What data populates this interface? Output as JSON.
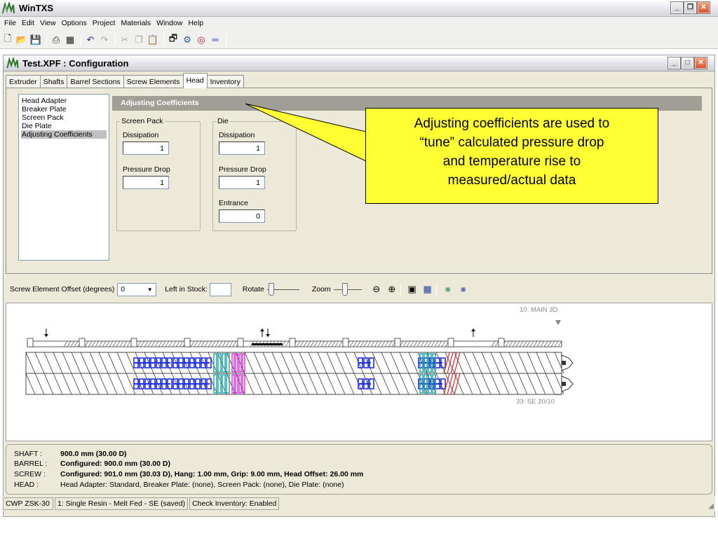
{
  "app": {
    "title": "WinTXS"
  },
  "menu": [
    "File",
    "Edit",
    "View",
    "Options",
    "Project",
    "Materials",
    "Window",
    "Help"
  ],
  "toolbar": {
    "icons": [
      "new-document-icon",
      "open-folder-icon",
      "save-icon",
      "print-icon",
      "print-preview-icon",
      "undo-icon",
      "redo-icon",
      "cut-icon",
      "copy-icon",
      "paste-icon",
      "properties-icon",
      "calculate-icon",
      "help-wheel-icon",
      "equals-icon"
    ]
  },
  "child_window": {
    "title": "Test.XPF : Configuration"
  },
  "tabs": [
    "Extruder",
    "Shafts",
    "Barrel Sections",
    "Screw Elements",
    "Head",
    "Inventory"
  ],
  "active_tab": "Head",
  "head_list": {
    "items": [
      "Head Adapter",
      "Breaker Plate",
      "Screen Pack",
      "Die Plate",
      "Adjusting Coefficients"
    ],
    "selected": "Adjusting Coefficients"
  },
  "section": {
    "title": "Adjusting Coefficients"
  },
  "screen_pack": {
    "legend": "Screen Pack",
    "dissipation_label": "Dissipation",
    "dissipation_value": "1",
    "pressure_drop_label": "Pressure Drop",
    "pressure_drop_value": "1"
  },
  "die": {
    "legend": "Die",
    "dissipation_label": "Dissipation",
    "dissipation_value": "1",
    "pressure_drop_label": "Pressure Drop",
    "pressure_drop_value": "1",
    "entrance_label": "Entrance",
    "entrance_value": "0"
  },
  "callout": {
    "lines": [
      "Adjusting coefficients are used to",
      "“tune” calculated pressure drop",
      "and temperature rise to",
      "measured/actual data"
    ],
    "fill": "#ffff33"
  },
  "screw_bar": {
    "offset_label": "Screw Element Offset (degrees)",
    "offset_value": "0",
    "stock_label": "Left in Stock:",
    "rotate_label": "Rotate",
    "zoom_label": "Zoom"
  },
  "drawing": {
    "top_label": "10: MAIN 3D",
    "bottom_label": "33: SE 20/10",
    "element_colors": {
      "blue": "#1f2fe0",
      "teal": "#1aa3a3",
      "magenta": "#d020d0",
      "red": "#e02020"
    }
  },
  "info": {
    "shaft_key": "SHAFT :",
    "shaft_val": "900.0 mm (30.00 D)",
    "barrel_key": "BARREL :",
    "barrel_val": "Configured: 900.0 mm (30.00 D)",
    "screw_key": "SCREW :",
    "screw_val": "Configured: 901.0 mm (30.03 D), Hang: 1.00 mm, Grip: 9.00 mm, Head Offset: 26.00 mm",
    "head_key": "HEAD :",
    "head_val": "Head Adapter: Standard,  Breaker Plate: (none),  Screen Pack: (none),  Die Plate: (none)"
  },
  "status": [
    "CWP ZSK-30",
    "1: Single Resin - Melt Fed - SE (saved)",
    "Check Inventory: Enabled"
  ]
}
